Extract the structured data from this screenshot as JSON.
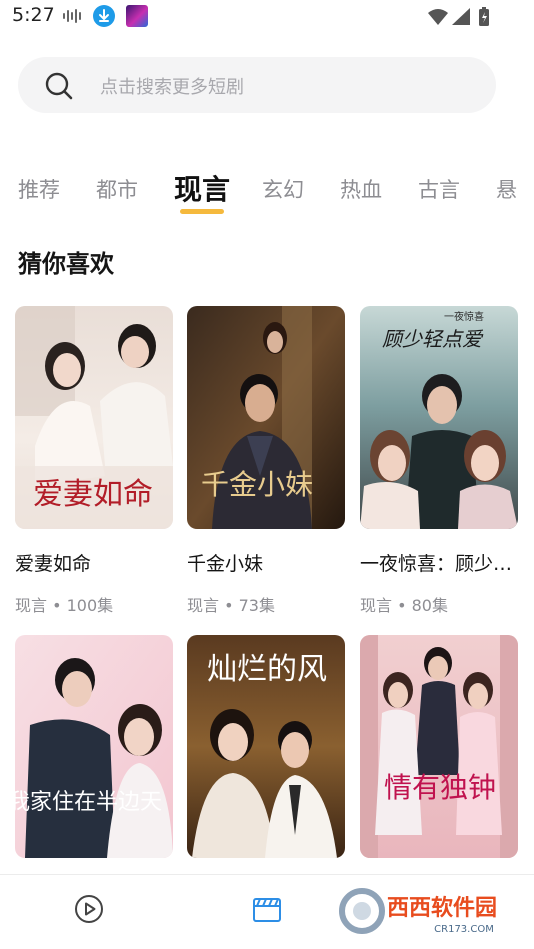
{
  "status_bar": {
    "time": "5:27"
  },
  "search": {
    "placeholder": "点击搜索更多短剧"
  },
  "tabs": [
    {
      "label": "推荐",
      "active": false
    },
    {
      "label": "都市",
      "active": false
    },
    {
      "label": "现言",
      "active": true
    },
    {
      "label": "玄幻",
      "active": false
    },
    {
      "label": "热血",
      "active": false
    },
    {
      "label": "古言",
      "active": false
    },
    {
      "label": "悬",
      "active": false
    }
  ],
  "section": {
    "title": "猜你喜欢"
  },
  "dramas": [
    {
      "title": "爱妻如命",
      "meta": "现言 • 100集",
      "poster_text": "爱妻如命"
    },
    {
      "title": "千金小妹",
      "meta": "现言 • 73集",
      "poster_text": "千金小妹"
    },
    {
      "title": "一夜惊喜：顾少轻点爱",
      "meta": "现言 • 80集",
      "poster_text": "顾少轻点爱",
      "poster_subtext": "一夜惊喜"
    },
    {
      "title": "",
      "meta": "",
      "poster_text": "我家住在半边天"
    },
    {
      "title": "",
      "meta": "",
      "poster_text": "灿烂的风"
    },
    {
      "title": "",
      "meta": "",
      "poster_text": "情有独钟"
    }
  ],
  "bottom_nav": [
    {
      "icon": "play-circle-icon",
      "active": false
    },
    {
      "icon": "clapperboard-icon",
      "active": true
    }
  ],
  "watermark": {
    "text": "西西软件园",
    "url_text": "CR173.COM"
  },
  "colors": {
    "accent": "#f5b93d",
    "active_nav": "#2d8ee6",
    "muted": "#8e8e93"
  }
}
